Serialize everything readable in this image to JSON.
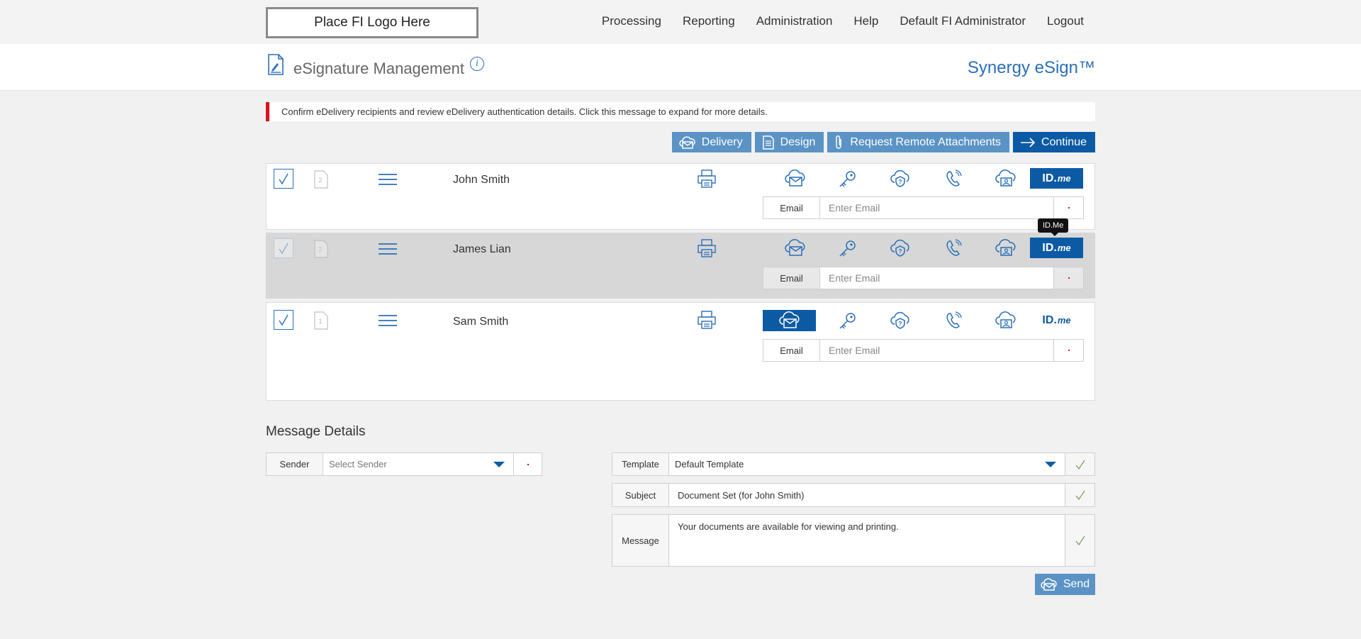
{
  "header": {
    "logo_text": "Place FI Logo Here",
    "nav": [
      "Processing",
      "Reporting",
      "Administration",
      "Help",
      "Default FI Administrator",
      "Logout"
    ]
  },
  "titlebar": {
    "title": "eSignature Management",
    "brand": "Synergy eSign™"
  },
  "alert": {
    "text": "Confirm eDelivery recipients and review eDelivery authentication details. Click this message to expand for more details.",
    "color": "#d7131b"
  },
  "actions": {
    "delivery": "Delivery",
    "design": "Design",
    "request_remote": "Request Remote Attachments",
    "continue": "Continue"
  },
  "recipients": [
    {
      "name": "John Smith",
      "page_badge": "2",
      "email_label": "Email",
      "email_placeholder": "Enter Email",
      "email_value": "",
      "selected": false,
      "active_method": "id-me"
    },
    {
      "name": "James Lian",
      "page_badge": "2",
      "email_label": "Email",
      "email_placeholder": "Enter Email",
      "email_value": "",
      "selected": true,
      "active_method": "id-me"
    },
    {
      "name": "Sam Smith",
      "page_badge": "1",
      "email_label": "Email",
      "email_placeholder": "Enter Email",
      "email_value": "",
      "selected": false,
      "active_method": "email-delivery"
    }
  ],
  "idme_label": {
    "strong": "ID.",
    "em": "me"
  },
  "tooltip": "ID.Me",
  "message_details": {
    "title": "Message Details",
    "sender_label": "Sender",
    "sender_placeholder": "Select Sender",
    "template_label": "Template",
    "template_value": "Default Template",
    "subject_label": "Subject",
    "subject_value": "Document Set (for John Smith)",
    "message_label": "Message",
    "message_value": "Your documents are available for viewing and printing.",
    "send_label": "Send"
  },
  "colors": {
    "accent": "#0d5aa4",
    "accent_light": "#5b93c5",
    "link": "#2a6fb8",
    "check_green": "#7aa35a"
  }
}
